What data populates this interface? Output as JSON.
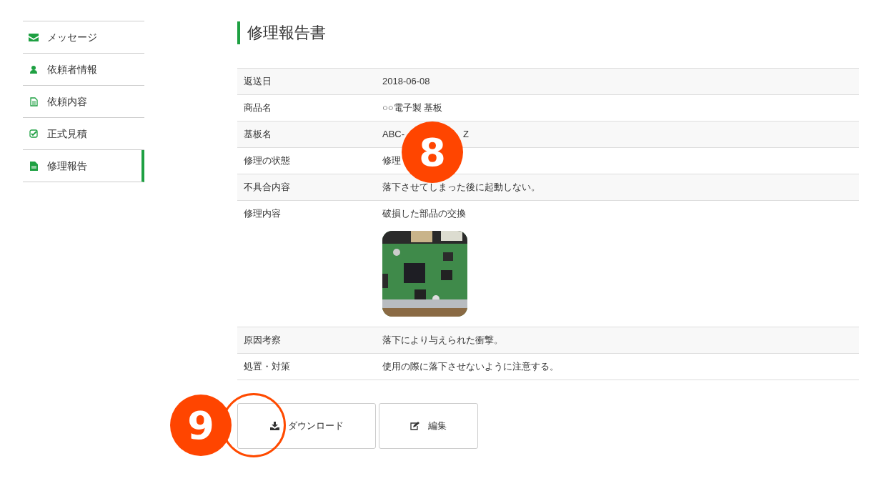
{
  "sidebar": {
    "items": [
      {
        "label": "メッセージ",
        "selected": false
      },
      {
        "label": "依頼者情報",
        "selected": false
      },
      {
        "label": "依頼内容",
        "selected": false
      },
      {
        "label": "正式見積",
        "selected": false
      },
      {
        "label": "修理報告",
        "selected": true
      }
    ]
  },
  "title": "修理報告書",
  "table": {
    "rows": [
      {
        "label": "返送日",
        "value": "2018-06-08"
      },
      {
        "label": "商品名",
        "value": "○○電子製 基板"
      },
      {
        "label": "基板名",
        "value": "ABC-",
        "value_tail": "Z"
      },
      {
        "label": "修理の状態",
        "value": "修理"
      },
      {
        "label": "不具合内容",
        "value": "落下させてしまった後に起動しない。"
      },
      {
        "label": "修理内容",
        "value": "破損した部品の交換"
      },
      {
        "label": "原因考察",
        "value": "落下により与えられた衝撃。"
      },
      {
        "label": "処置・対策",
        "value": "使用の際に落下させないように注意する。"
      }
    ]
  },
  "buttons": [
    {
      "label": "ダウンロード"
    },
    {
      "label": "編集"
    }
  ],
  "annotations": [
    {
      "number": "8"
    },
    {
      "number": "9"
    }
  ]
}
